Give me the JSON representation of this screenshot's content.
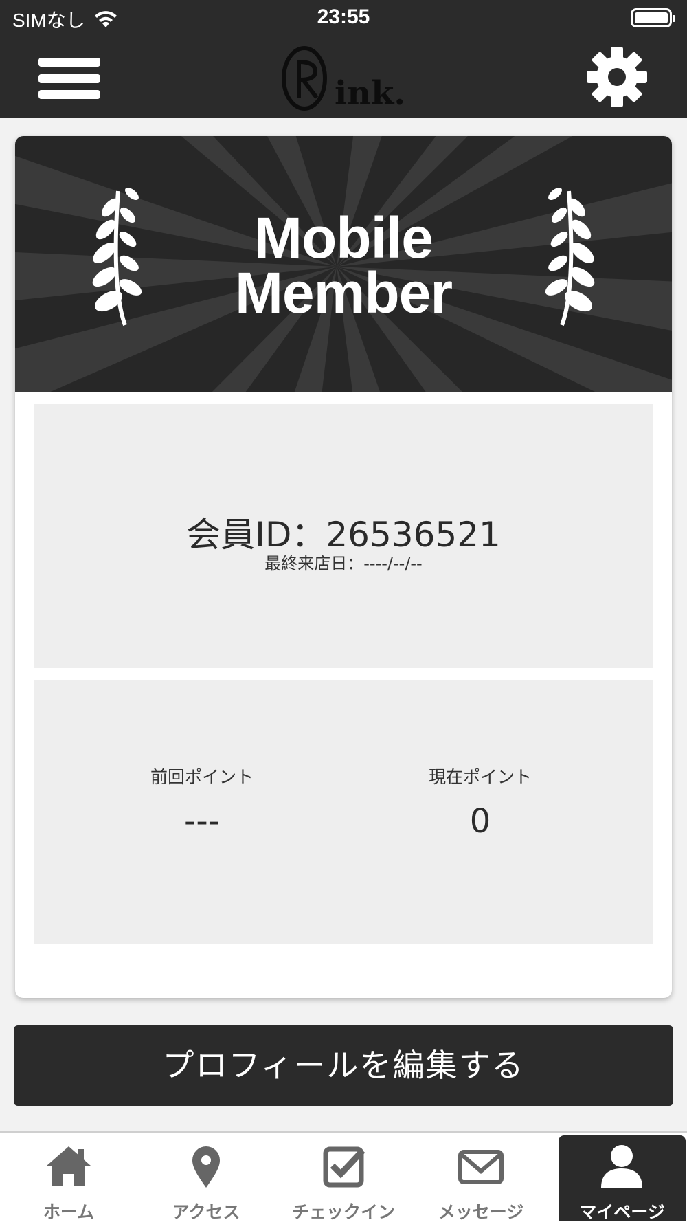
{
  "status_bar": {
    "carrier": "SIMなし",
    "time": "23:55"
  },
  "header": {
    "logo_text": "Rink.",
    "menu_icon": "hamburger-menu-icon",
    "settings_icon": "gear-icon"
  },
  "banner": {
    "title_line1": "Mobile",
    "title_line2": "Member"
  },
  "member": {
    "id_label": "会員ID：26536521",
    "last_visit": "最終来店日：----/--/--"
  },
  "points": {
    "previous_label": "前回ポイント",
    "previous_value": "---",
    "current_label": "現在ポイント",
    "current_value": "0"
  },
  "edit_profile_label": "プロフィールを編集する",
  "tabs": [
    {
      "label": "ホーム",
      "icon": "home-icon"
    },
    {
      "label": "アクセス",
      "icon": "map-pin-icon"
    },
    {
      "label": "チェックイン",
      "icon": "checkbox-icon"
    },
    {
      "label": "メッセージ",
      "icon": "envelope-icon"
    },
    {
      "label": "マイページ",
      "icon": "user-icon",
      "active": true
    }
  ],
  "colors": {
    "header_bg": "#2b2b2b",
    "panel_bg": "#eeeeee",
    "text_dark": "#2a2a2a",
    "tab_inactive": "#777777"
  }
}
